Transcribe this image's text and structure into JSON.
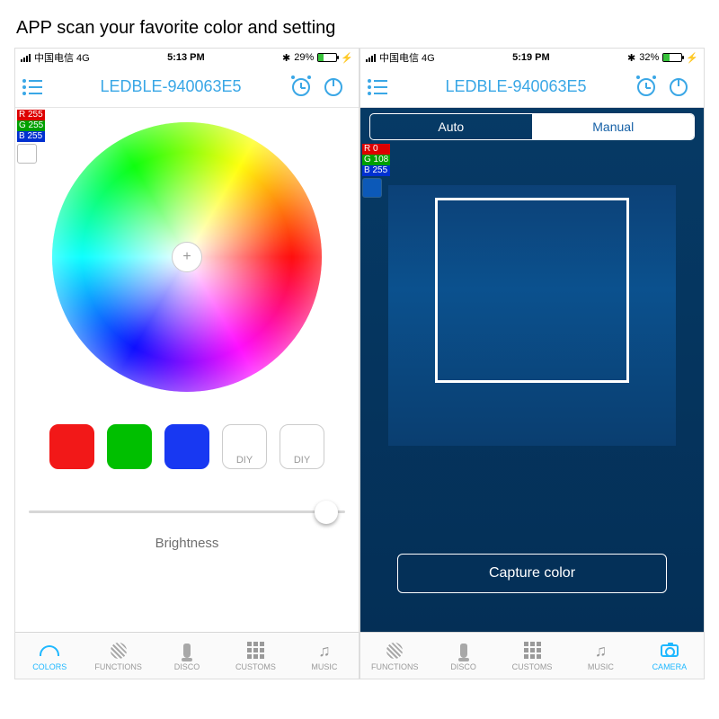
{
  "caption": "APP scan your favorite color and setting",
  "left": {
    "status": {
      "carrier": "中国电信  4G",
      "time": "5:13 PM",
      "bt": "✱",
      "battery_pct": "29%",
      "battery_fill": 29
    },
    "nav": {
      "title": "LEDBLE-940063E5"
    },
    "rgb": {
      "r": "R 255",
      "g": "G 255",
      "b": "B 255"
    },
    "presets": {
      "diy": "DIY"
    },
    "slider": {
      "label": "Brightness",
      "pos_pct": 94
    },
    "tabs": [
      "COLORS",
      "FUNCTIONS",
      "DISCO",
      "CUSTOMS",
      "MUSIC"
    ],
    "active_tab": 0
  },
  "right": {
    "status": {
      "carrier": "中国电信  4G",
      "time": "5:19 PM",
      "bt": "✱",
      "battery_pct": "32%",
      "battery_fill": 32
    },
    "nav": {
      "title": "LEDBLE-940063E5"
    },
    "seg": {
      "auto": "Auto",
      "manual": "Manual"
    },
    "rgb": {
      "r": "R  0",
      "g": "G 108",
      "b": "B 255"
    },
    "capture": "Capture color",
    "tabs": [
      "FUNCTIONS",
      "DISCO",
      "CUSTOMS",
      "MUSIC",
      "CAMERA"
    ],
    "active_tab": 4
  }
}
